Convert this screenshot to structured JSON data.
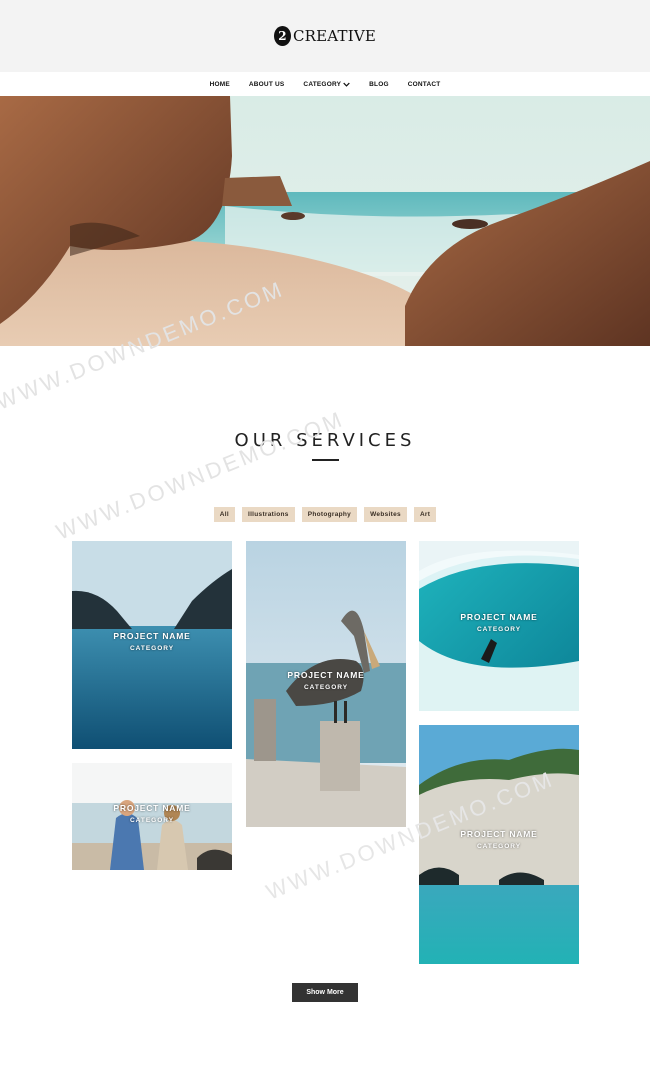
{
  "brand": {
    "mark": "2",
    "name": "CREATIVE"
  },
  "nav": {
    "items": [
      {
        "label": "HOME"
      },
      {
        "label": "ABOUT US"
      },
      {
        "label": "CATEGORY"
      },
      {
        "label": "BLOG"
      },
      {
        "label": "CONTACT"
      }
    ]
  },
  "services": {
    "title": "OUR SERVICES",
    "filters": [
      "All",
      "Illustrations",
      "Photography",
      "Websites",
      "Art"
    ],
    "projects": [
      {
        "name": "PROJECT NAME",
        "category": "CATEGORY"
      },
      {
        "name": "PROJECT NAME",
        "category": "CATEGORY"
      },
      {
        "name": "PROJECT NAME",
        "category": "CATEGORY"
      },
      {
        "name": "PROJECT NAME",
        "category": "CATEGORY"
      },
      {
        "name": "PROJECT NAME",
        "category": "CATEGORY"
      }
    ],
    "show_more": "Show More"
  },
  "watermark": "WWW.DOWNDEMO.COM"
}
